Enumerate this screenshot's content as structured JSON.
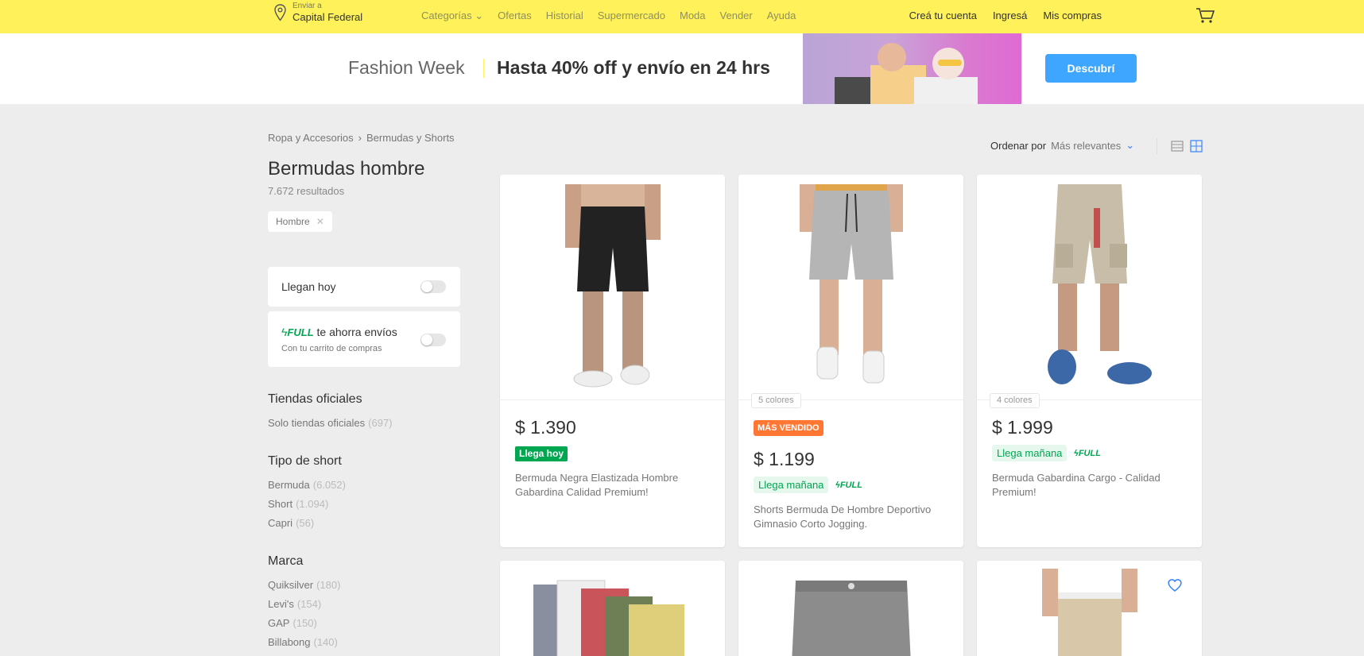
{
  "header": {
    "location_label": "Enviar a",
    "location_value": "Capital Federal",
    "nav": [
      "Categorías",
      "Ofertas",
      "Historial",
      "Supermercado",
      "Moda",
      "Vender",
      "Ayuda"
    ],
    "account": [
      "Creá tu cuenta",
      "Ingresá",
      "Mis compras"
    ]
  },
  "banner": {
    "label": "Fashion Week",
    "headline": "Hasta 40% off y envío en 24 hrs",
    "button": "Descubrí"
  },
  "breadcrumb": [
    "Ropa y Accesorios",
    "Bermudas y Shorts"
  ],
  "page": {
    "title": "Bermudas hombre",
    "results": "7.672 resultados",
    "chip": "Hombre"
  },
  "filters": {
    "today_label": "Llegan hoy",
    "full_tag": "FULL",
    "full_label": "te ahorra envíos",
    "full_sub": "Con tu carrito de compras",
    "groups": [
      {
        "title": "Tiendas oficiales",
        "items": [
          {
            "label": "Solo tiendas oficiales",
            "count": "(697)"
          }
        ]
      },
      {
        "title": "Tipo de short",
        "items": [
          {
            "label": "Bermuda",
            "count": "(6.052)"
          },
          {
            "label": "Short",
            "count": "(1.094)"
          },
          {
            "label": "Capri",
            "count": "(56)"
          }
        ]
      },
      {
        "title": "Marca",
        "items": [
          {
            "label": "Quiksilver",
            "count": "(180)"
          },
          {
            "label": "Levi's",
            "count": "(154)"
          },
          {
            "label": "GAP",
            "count": "(150)"
          },
          {
            "label": "Billabong",
            "count": "(140)"
          }
        ]
      }
    ]
  },
  "sort": {
    "label": "Ordenar por",
    "value": "Más relevantes"
  },
  "products": [
    {
      "price": "$ 1.390",
      "badge": "Llega hoy",
      "title": "Bermuda Negra Elastizada Hombre Gabardina Calidad Premium!"
    },
    {
      "colors": "5 colores",
      "tag": "MÁS VENDIDO",
      "price": "$ 1.199",
      "arrive": "Llega mañana",
      "full": "FULL",
      "title": "Shorts Bermuda De Hombre Deportivo Gimnasio Corto Jogging."
    },
    {
      "colors": "4 colores",
      "price": "$ 1.999",
      "arrive": "Llega mañana",
      "full": "FULL",
      "title": "Bermuda Gabardina Cargo - Calidad Premium!"
    }
  ],
  "colors": {
    "header_bg": "#fff159",
    "accent_blue": "#3483fa",
    "green": "#00a650",
    "orange": "#ff7733"
  }
}
